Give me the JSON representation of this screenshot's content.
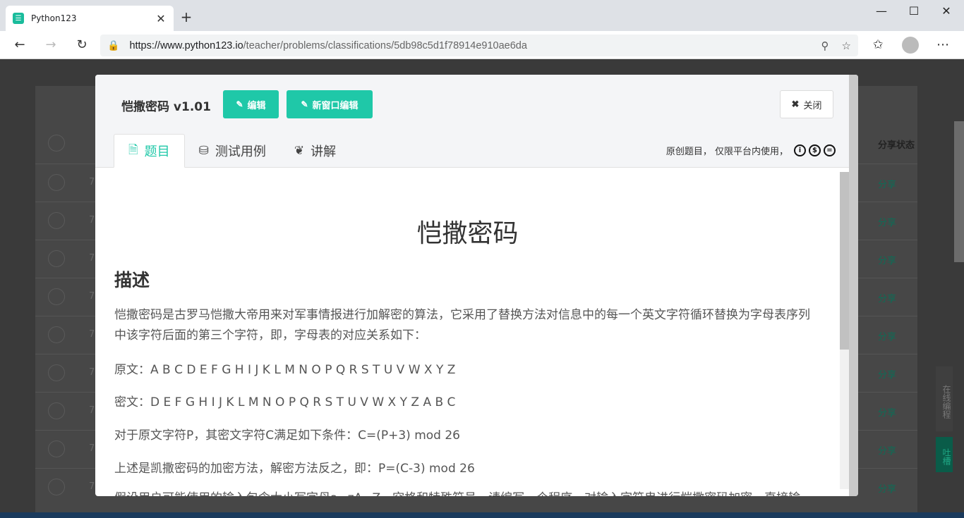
{
  "browser": {
    "tab_title": "Python123",
    "tab_favicon": "☉",
    "url_host": "https://www.python123.io",
    "url_path": "/teacher/problems/classifications/5db98c5d1f78914e910ae6da"
  },
  "background": {
    "header_share": "分享状态",
    "share_label": "分享",
    "row_prefix": "7",
    "side_tab_label": "在线编程",
    "side_tab2_label": "吐槽"
  },
  "modal": {
    "title": "恺撒密码 v1.01",
    "edit_label": "编辑",
    "new_window_edit_label": "新窗口编辑",
    "close_label": "关闭",
    "tabs": [
      {
        "label": "题目",
        "icon": "file-text-icon"
      },
      {
        "label": "测试用例",
        "icon": "cubes-icon"
      },
      {
        "label": "讲解",
        "icon": "leaf-icon"
      }
    ],
    "license_text": "原创题目，  仅限平台内使用，",
    "license_icons": [
      "cc-by-icon",
      "cc-nc-icon",
      "cc-nd-icon"
    ]
  },
  "doc": {
    "title": "恺撒密码",
    "section_heading": "描述",
    "paragraphs": [
      "恺撒密码是古罗马恺撒大帝用来对军事情报进行加解密的算法，它采用了替换方法对信息中的每一个英文字符循环替换为字母表序列中该字符后面的第三个字符，即，字母表的对应关系如下：",
      "原文：A B C D E F G H I J K L M N O P Q R S T U V W X Y Z",
      "密文：D E F G H I J K L M N O P Q R S T U V W X Y Z A B C",
      "对于原文字符P，其密文字符C满足如下条件：C=(P+3) mod 26",
      "上述是凯撒密码的加密方法，解密方法反之，即：P=(C-3) mod 26",
      "假设用户可能使用的输入包含大小写字母a~zA~Z、空格和特殊符号，请编写一个程序，对输入字符串进行恺撒密码加密，直接输"
    ]
  }
}
